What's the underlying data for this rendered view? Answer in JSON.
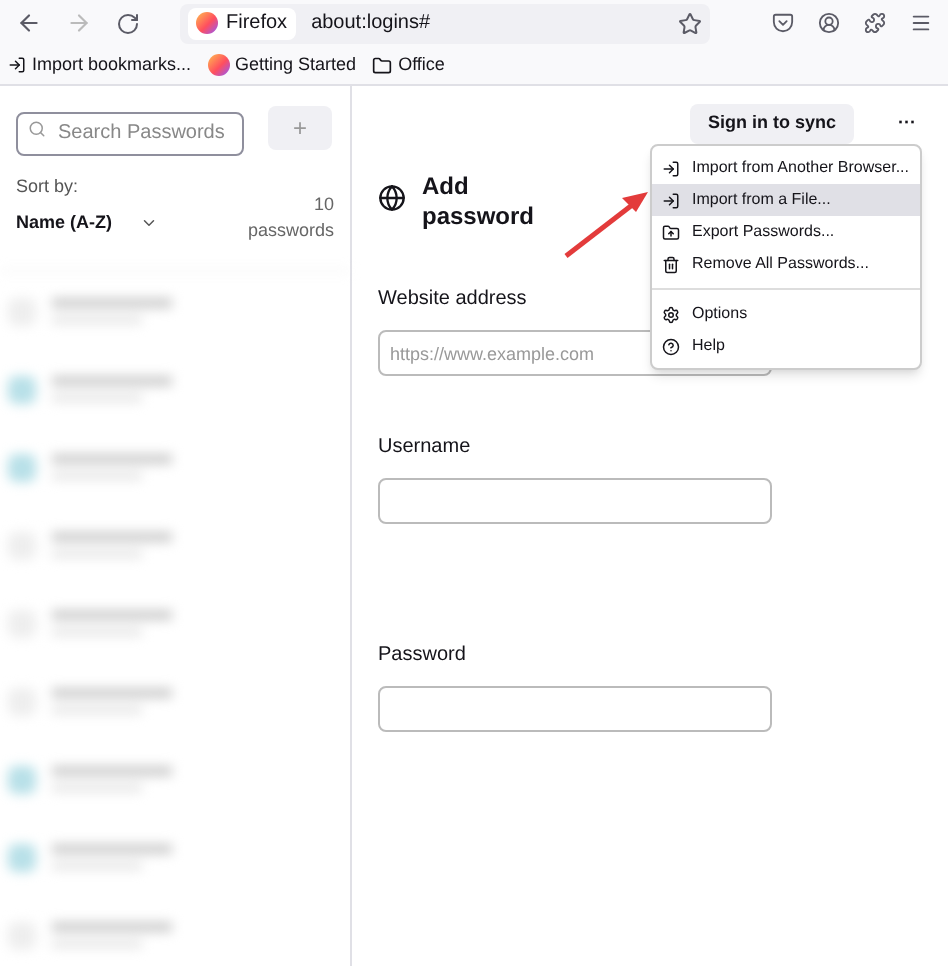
{
  "toolbar": {
    "identity_label": "Firefox",
    "url": "about:logins#"
  },
  "bookmarks": [
    {
      "label": "Import bookmarks..."
    },
    {
      "label": "Getting Started"
    },
    {
      "label": "Office"
    }
  ],
  "sidebar": {
    "search": {
      "placeholder": "Search Passwords"
    },
    "add_button": "+",
    "sort_label": "Sort by:",
    "sort_value": "Name (A-Z)",
    "count": "10",
    "count_label": "passwords"
  },
  "header": {
    "sign_in": "Sign in to sync",
    "more": "···"
  },
  "form": {
    "title": "Add password",
    "fields": [
      {
        "label": "Website address",
        "placeholder": "https://www.example.com"
      },
      {
        "label": "Username"
      },
      {
        "label": "Password"
      }
    ]
  },
  "menu": {
    "items": [
      {
        "kind": "item",
        "label": "Import from Another Browser...",
        "selected": false
      },
      {
        "kind": "item",
        "label": "Import from a File...",
        "selected": true
      },
      {
        "kind": "item",
        "label": "Export Passwords...",
        "selected": false
      },
      {
        "kind": "item",
        "label": "Remove All Passwords...",
        "selected": false
      },
      {
        "kind": "separator"
      },
      {
        "kind": "item",
        "label": "Options",
        "selected": false
      },
      {
        "kind": "item",
        "label": "Help",
        "selected": false
      }
    ]
  }
}
